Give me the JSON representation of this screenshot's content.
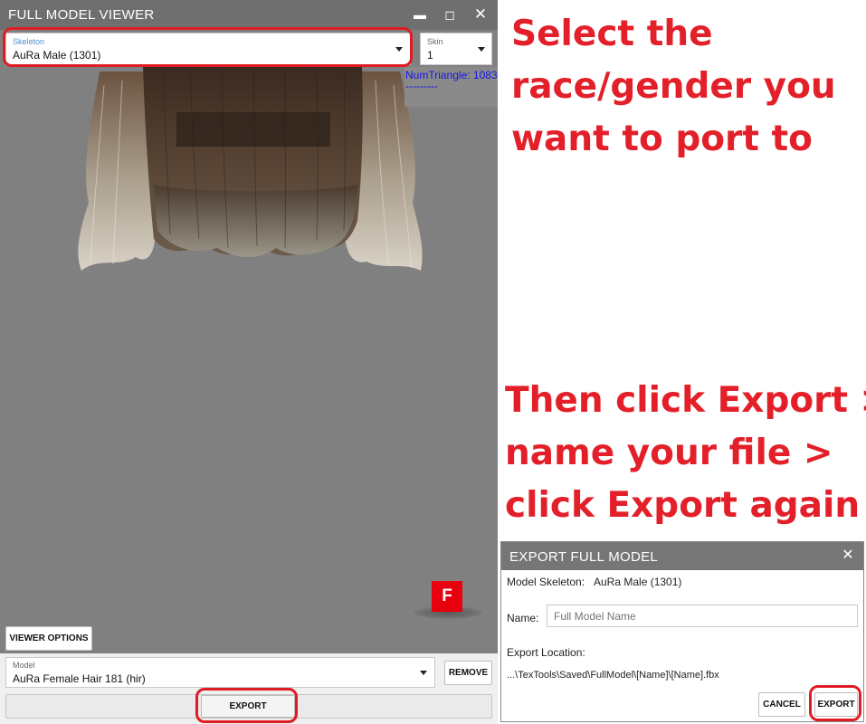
{
  "viewer": {
    "title": "FULL MODEL VIEWER",
    "skeleton": {
      "label": "Skeleton",
      "value": "AuRa Male (1301)"
    },
    "skin": {
      "label": "Skin",
      "value": "1"
    },
    "triangle_info": "NumTriangle: 1083",
    "triangle_dash": "---------",
    "axis_marker": "F",
    "viewer_options_label": "VIEWER OPTIONS",
    "model": {
      "label": "Model",
      "value": "AuRa Female Hair 181 (hir)"
    },
    "remove_label": "REMOVE",
    "export_label": "EXPORT"
  },
  "instructions": {
    "line1": [
      "Select the",
      "race/gender you",
      "want to port to"
    ],
    "line2": [
      "Then click Export >",
      "name your file >",
      "click Export again"
    ]
  },
  "dialog": {
    "title": "EXPORT FULL MODEL",
    "skeleton_label": "Model Skeleton:",
    "skeleton_value": "AuRa Male (1301)",
    "name_label": "Name:",
    "name_placeholder": "Full Model Name",
    "location_label": "Export Location:",
    "location_value": "...\\TexTools\\Saved\\FullModel\\[Name]\\[Name].fbx",
    "cancel_label": "CANCEL",
    "export_label": "EXPORT"
  },
  "colors": {
    "annotation_red": "#e3202a",
    "viewport_gray": "#808080",
    "hair_brown": "#5a4636"
  }
}
